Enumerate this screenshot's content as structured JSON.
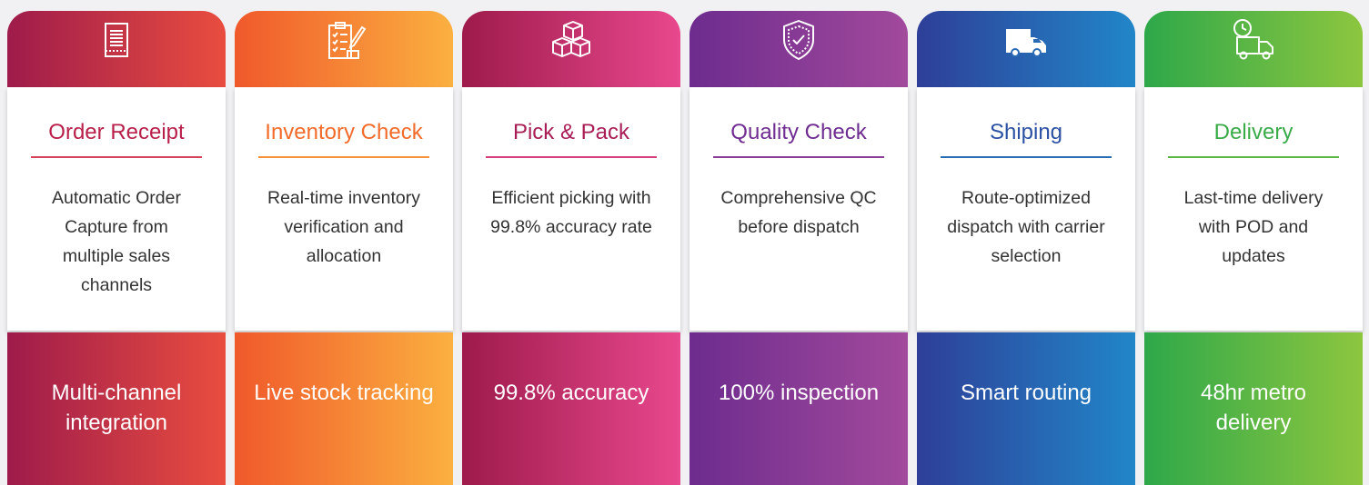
{
  "stages": [
    {
      "icon": "document-icon",
      "title": "Order Receipt",
      "description": "Automatic Order Capture from multiple sales channels",
      "highlight": "Multi-channel integration",
      "colors": {
        "from": "#9e1b4b",
        "to": "#e94d3f",
        "title": "#b81f4a",
        "rule": "#d6415b"
      }
    },
    {
      "icon": "clipboard-checklist-icon",
      "title": "Inventory Check",
      "description": "Real-time inventory verification and allocation",
      "highlight": "Live stock tracking",
      "colors": {
        "from": "#f0592b",
        "to": "#fbb040",
        "title": "#f26b2a",
        "rule": "#f7913a"
      }
    },
    {
      "icon": "boxes-icon",
      "title": "Pick & Pack",
      "description": "Efficient picking with 99.8% accuracy rate",
      "highlight": "99.8% accuracy",
      "colors": {
        "from": "#9e1b4b",
        "to": "#e8488d",
        "title": "#a81d55",
        "rule": "#d63d7c"
      }
    },
    {
      "icon": "shield-check-icon",
      "title": "Quality Check",
      "description": "Comprehensive QC before dispatch",
      "highlight": "100% inspection",
      "colors": {
        "from": "#6d2c8e",
        "to": "#a24a9c",
        "title": "#6f2c91",
        "rule": "#8c3d97"
      }
    },
    {
      "icon": "delivery-van-icon",
      "title": "Shiping",
      "description": "Route-optimized dispatch with carrier selection",
      "highlight": "Smart routing",
      "colors": {
        "from": "#2e3f98",
        "to": "#2186c8",
        "title": "#2b51a3",
        "rule": "#2a6db5"
      }
    },
    {
      "icon": "timed-delivery-truck-icon",
      "title": "Delivery",
      "description": "Last-time delivery with POD and updates",
      "highlight": "48hr metro delivery",
      "colors": {
        "from": "#2ea84a",
        "to": "#8dc63f",
        "title": "#3aab49",
        "rule": "#5bb847"
      }
    }
  ]
}
